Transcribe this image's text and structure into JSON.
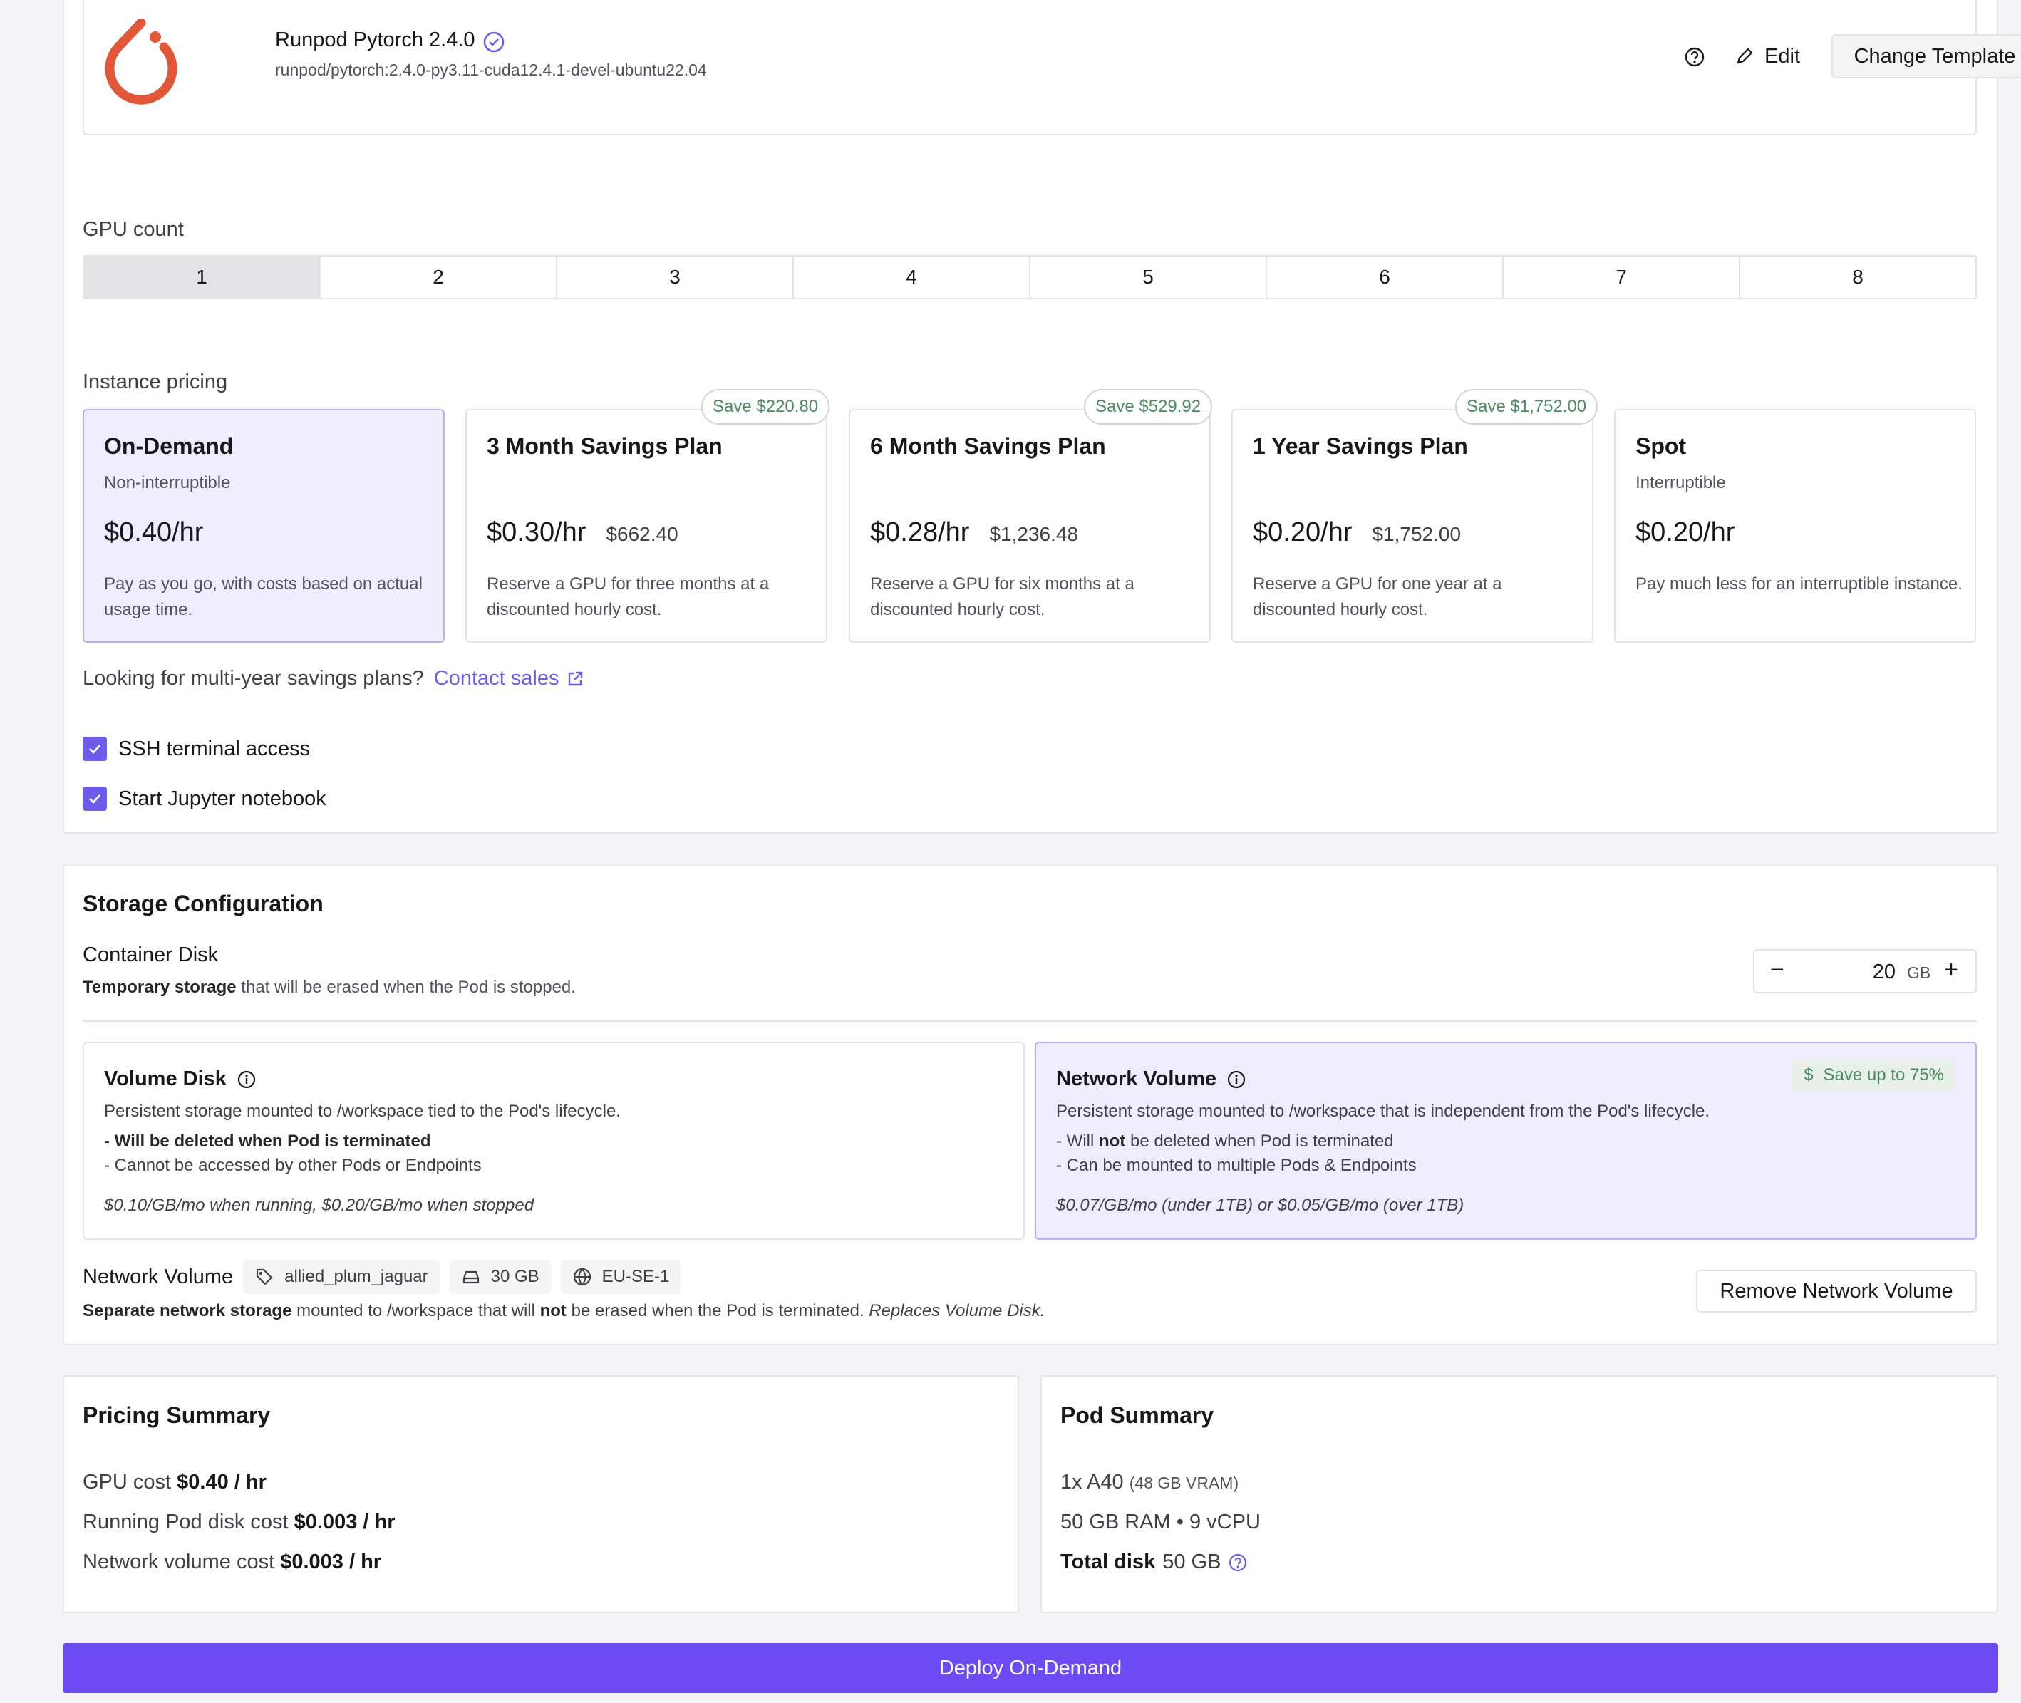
{
  "template": {
    "name": "Runpod Pytorch 2.4.0",
    "image": "runpod/pytorch:2.4.0-py3.11-cuda12.4.1-devel-ubuntu22.04",
    "edit_label": "Edit",
    "change_label": "Change Template"
  },
  "gpu_count": {
    "label": "GPU count",
    "options": [
      "1",
      "2",
      "3",
      "4",
      "5",
      "6",
      "7",
      "8"
    ],
    "selected": "1"
  },
  "pricing": {
    "label": "Instance pricing",
    "plans": [
      {
        "title": "On-Demand",
        "subtitle": "Non-interruptible",
        "price": "$0.40/hr",
        "total": "",
        "save": "",
        "description": "Pay as you go, with costs based on actual usage time.",
        "selected": true
      },
      {
        "title": "3 Month Savings Plan",
        "subtitle": "",
        "price": "$0.30/hr",
        "total": "$662.40",
        "save": "Save $220.80",
        "description": "Reserve a GPU for three months at a discounted hourly cost.",
        "selected": false
      },
      {
        "title": "6 Month Savings Plan",
        "subtitle": "",
        "price": "$0.28/hr",
        "total": "$1,236.48",
        "save": "Save $529.92",
        "description": "Reserve a GPU for six months at a discounted hourly cost.",
        "selected": false
      },
      {
        "title": "1 Year Savings Plan",
        "subtitle": "",
        "price": "$0.20/hr",
        "total": "$1,752.00",
        "save": "Save $1,752.00",
        "description": "Reserve a GPU for one year at a discounted hourly cost.",
        "selected": false
      },
      {
        "title": "Spot",
        "subtitle": "Interruptible",
        "price": "$0.20/hr",
        "total": "",
        "save": "",
        "description": "Pay much less for an interruptible instance.",
        "selected": false
      }
    ],
    "multi_year_text": "Looking for multi-year savings plans?",
    "contact_label": "Contact sales"
  },
  "options": {
    "ssh_label": "SSH terminal access",
    "jupyter_label": "Start Jupyter notebook"
  },
  "storage": {
    "title": "Storage Configuration",
    "container_disk": {
      "label": "Container Disk",
      "desc_bold": "Temporary storage",
      "desc_rest": "that will be erased when the Pod is stopped.",
      "value": "20",
      "unit": "GB"
    },
    "volume_disk": {
      "title": "Volume Disk",
      "desc": "Persistent storage mounted to /workspace tied to the Pod's lifecycle.",
      "line1": "- Will be deleted when Pod is terminated",
      "line2": "- Cannot be accessed by other Pods or Endpoints",
      "price": "$0.10/GB/mo when running, $0.20/GB/mo when stopped"
    },
    "network_volume": {
      "title": "Network Volume",
      "badge": "Save up to 75%",
      "desc": "Persistent storage mounted to /workspace that is independent from the Pod's lifecycle.",
      "line1_a": "- Will",
      "line1_b": "not",
      "line1_c": "be deleted when Pod is terminated",
      "line2": "- Can be mounted to multiple Pods & Endpoints",
      "price": "$0.07/GB/mo (under 1TB) or $0.05/GB/mo (over 1TB)"
    },
    "attached": {
      "label": "Network Volume",
      "name": "allied_plum_jaguar",
      "size": "30 GB",
      "region": "EU-SE-1",
      "desc_bold": "Separate network storage",
      "desc_mid": "mounted to /workspace that will",
      "desc_not": "not",
      "desc_end": "be erased when the Pod is terminated.",
      "desc_italic": "Replaces Volume Disk.",
      "remove_label": "Remove Network Volume"
    }
  },
  "pricing_summary": {
    "title": "Pricing Summary",
    "gpu_label": "GPU cost",
    "gpu_value": "$0.40 / hr",
    "disk_label": "Running Pod disk cost",
    "disk_value": "$0.003 / hr",
    "nv_label": "Network volume cost",
    "nv_value": "$0.003 / hr"
  },
  "pod_summary": {
    "title": "Pod Summary",
    "gpu": "1x A40",
    "vram": "(48 GB VRAM)",
    "specs": "50 GB RAM • 9 vCPU",
    "disk_label": "Total disk",
    "disk_value": "50 GB"
  },
  "deploy_label": "Deploy On-Demand",
  "colors": {
    "accent": "#6c4cf2",
    "selected_bg": "#efedfd",
    "save_green": "#4d8a60",
    "pytorch": "#e0573a"
  }
}
